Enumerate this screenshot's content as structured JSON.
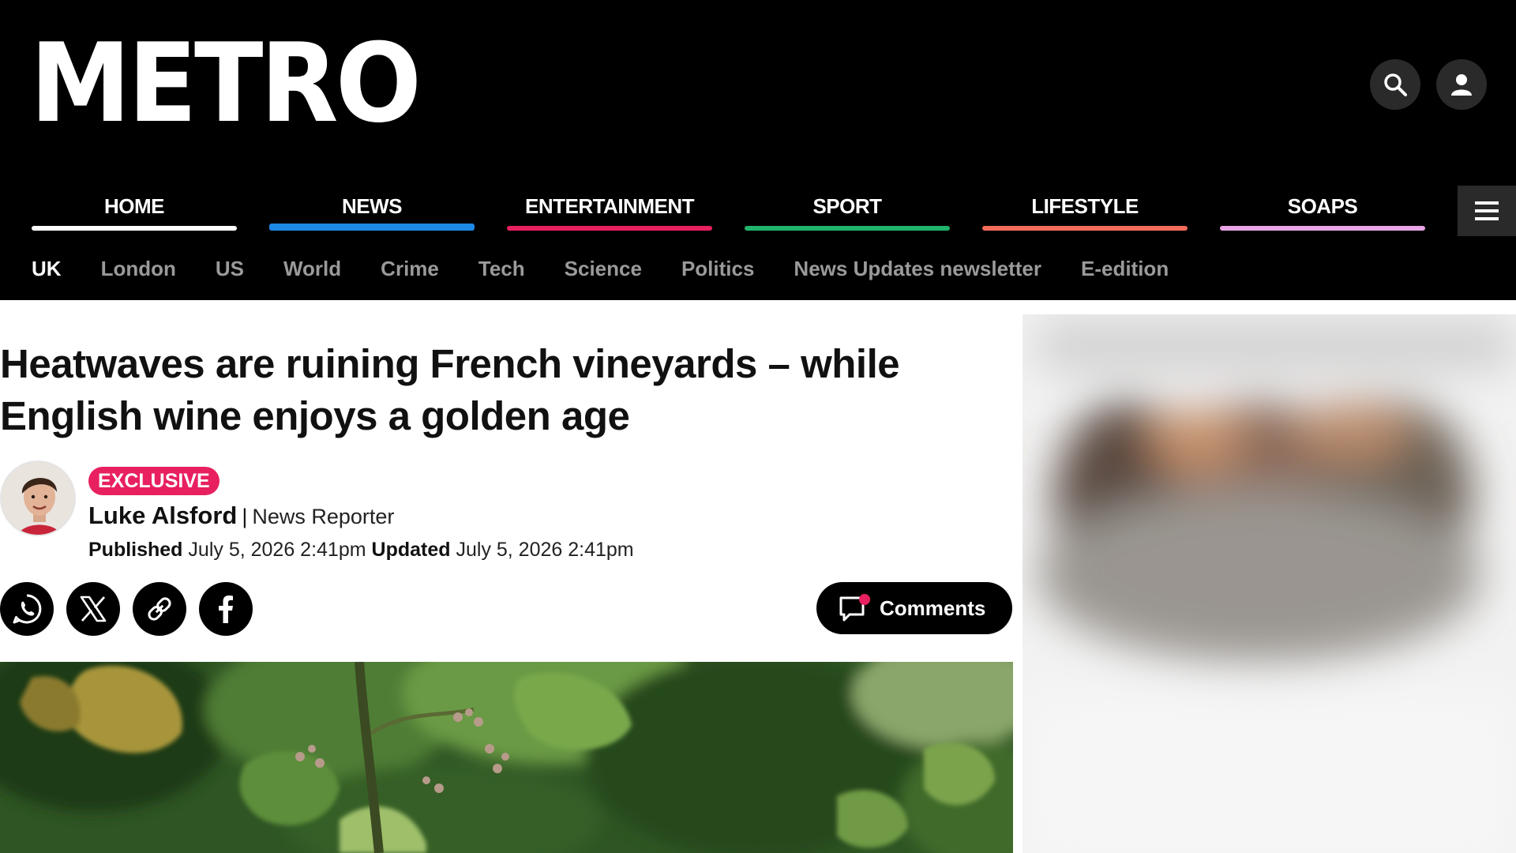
{
  "header": {
    "logo": "METRO",
    "search_icon": "search-icon",
    "account_icon": "user-icon"
  },
  "primary_nav": [
    {
      "label": "HOME",
      "color": "#ffffff"
    },
    {
      "label": "NEWS",
      "color": "#1e88e5"
    },
    {
      "label": "ENTERTAINMENT",
      "color": "#e8205f"
    },
    {
      "label": "SPORT",
      "color": "#1fb36b"
    },
    {
      "label": "LIFESTYLE",
      "color": "#f26b5b"
    },
    {
      "label": "SOAPS",
      "color": "#e7a3e3"
    }
  ],
  "menu_icon": "hamburger-menu-icon",
  "sub_nav": [
    {
      "label": "UK",
      "active": true
    },
    {
      "label": "London"
    },
    {
      "label": "US"
    },
    {
      "label": "World"
    },
    {
      "label": "Crime"
    },
    {
      "label": "Tech"
    },
    {
      "label": "Science"
    },
    {
      "label": "Politics"
    },
    {
      "label": "News Updates newsletter"
    },
    {
      "label": "E-edition"
    }
  ],
  "article": {
    "headline": "Heatwaves are ruining French vineyards – while English wine enjoys a golden age",
    "badge": "EXCLUSIVE",
    "author_name": "Luke Alsford",
    "separator": "|",
    "author_role": "News Reporter",
    "published_label": "Published",
    "published_date": "July 5, 2026 2:41pm",
    "updated_label": "Updated",
    "updated_date": "July 5, 2026 2:41pm",
    "comments_label": "Comments"
  },
  "share": [
    "whatsapp-icon",
    "x-icon",
    "link-icon",
    "facebook-icon"
  ],
  "colors": {
    "header_bg": "#000000",
    "badge_bg": "#e8205f",
    "comments_dot": "#e8205f"
  }
}
